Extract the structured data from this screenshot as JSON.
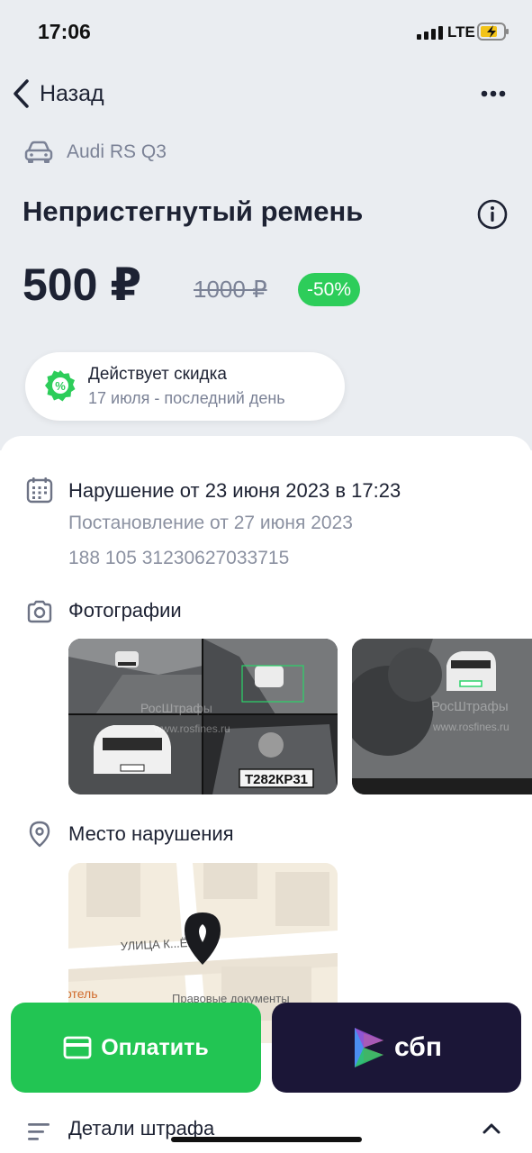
{
  "status_bar": {
    "time": "17:06",
    "network": "LTE"
  },
  "nav": {
    "back_label": "Назад",
    "more_icon": "more-horizontal-icon"
  },
  "car": {
    "icon": "car-icon",
    "name": "Audi RS Q3"
  },
  "fine": {
    "title": "Непристегнутый ремень",
    "price": "500 ₽",
    "old_price": "1000 ₽",
    "discount": "-50%"
  },
  "discount_card": {
    "icon": "percent-badge-icon",
    "title": "Действует скидка",
    "subtitle": "17 июля - последний день"
  },
  "violation": {
    "icon": "calendar-icon",
    "title": "Нарушение от 23 июня 2023 в 17:23",
    "decree": "Постановление от 27 июня 2023",
    "uin": "188 105 31230627033715"
  },
  "photos": {
    "icon": "camera-icon",
    "label": "Фотографии",
    "plate_text": "Т282КР31",
    "watermark_1": "РосШтрафы",
    "watermark_2": "www.rosfines.ru"
  },
  "place": {
    "icon": "location-pin-icon",
    "label": "Место нарушения",
    "street": "УЛИЦА К...ЁВА",
    "poi_1": "Правовые документы",
    "poi_2": "отель"
  },
  "actions": {
    "pay_label": "Оплатить",
    "sbp_label": "сбп"
  },
  "details": {
    "label": "Детали штрафа"
  },
  "colors": {
    "accent_green": "#22c553",
    "badge_green": "#2dcd5a",
    "sbp_bg": "#1b1637",
    "header_bg": "#eaedf1",
    "text_dark": "#1d2233",
    "text_muted": "#8b91a1"
  }
}
